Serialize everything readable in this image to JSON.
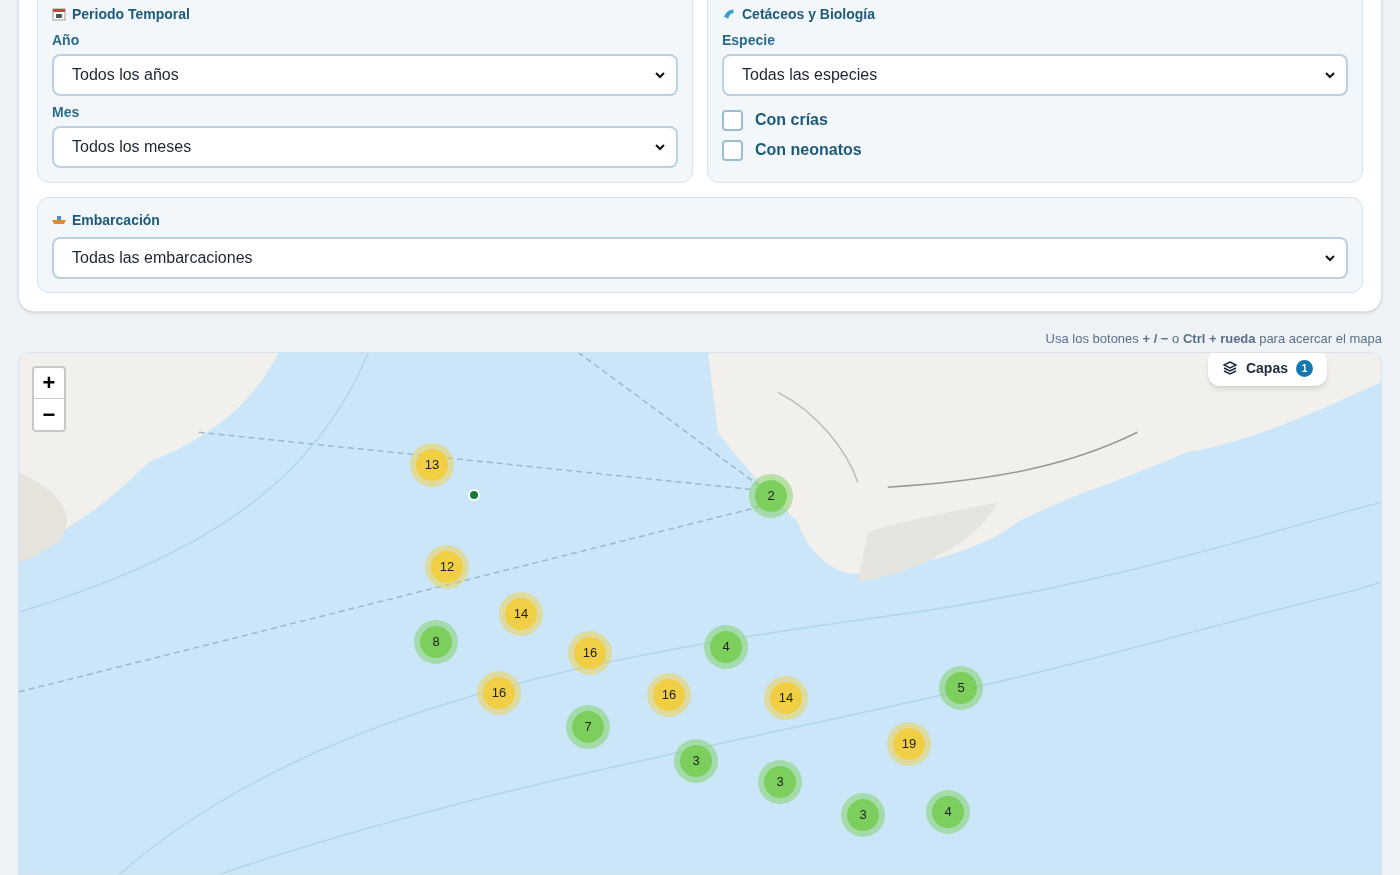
{
  "filters": {
    "period": {
      "title": "Periodo Temporal",
      "fields": [
        {
          "label": "Año",
          "value": "Todos los años"
        },
        {
          "label": "Mes",
          "value": "Todos los meses"
        }
      ]
    },
    "biology": {
      "title": "Cetáceos y Biología",
      "field": {
        "label": "Especie",
        "value": "Todas las especies"
      },
      "checkboxes": [
        {
          "label": "Con crías",
          "checked": false
        },
        {
          "label": "Con neonatos",
          "checked": false
        }
      ]
    },
    "vessel": {
      "title": "Embarcación",
      "value": "Todas las embarcaciones"
    }
  },
  "map_hint": "Usa los botones **+ / −** o **Ctrl + rueda** para acercar el mapa",
  "map": {
    "zoom_in": "+",
    "zoom_out": "−",
    "layers": {
      "label": "Capas",
      "count": "1"
    },
    "clusters": [
      {
        "count": "13",
        "color": "#f0cf45"
      },
      {
        "count": "2",
        "color": "#7ccf5c"
      },
      {
        "count": "12",
        "color": "#f0cf45"
      },
      {
        "count": "14",
        "color": "#f0cf45"
      },
      {
        "count": "8",
        "color": "#7ccf5c"
      },
      {
        "count": "16",
        "color": "#f0cf45"
      },
      {
        "count": "4",
        "color": "#7ccf5c"
      },
      {
        "count": "16",
        "color": "#f0cf45"
      },
      {
        "count": "16",
        "color": "#f0cf45"
      },
      {
        "count": "14",
        "color": "#f0cf45"
      },
      {
        "count": "5",
        "color": "#7ccf5c"
      },
      {
        "count": "7",
        "color": "#7ccf5c"
      },
      {
        "count": "19",
        "color": "#f0cf45"
      },
      {
        "count": "3",
        "color": "#7ccf5c"
      },
      {
        "count": "3",
        "color": "#7ccf5c"
      },
      {
        "count": "3",
        "color": "#7ccf5c"
      },
      {
        "count": "4",
        "color": "#7ccf5c"
      }
    ]
  }
}
